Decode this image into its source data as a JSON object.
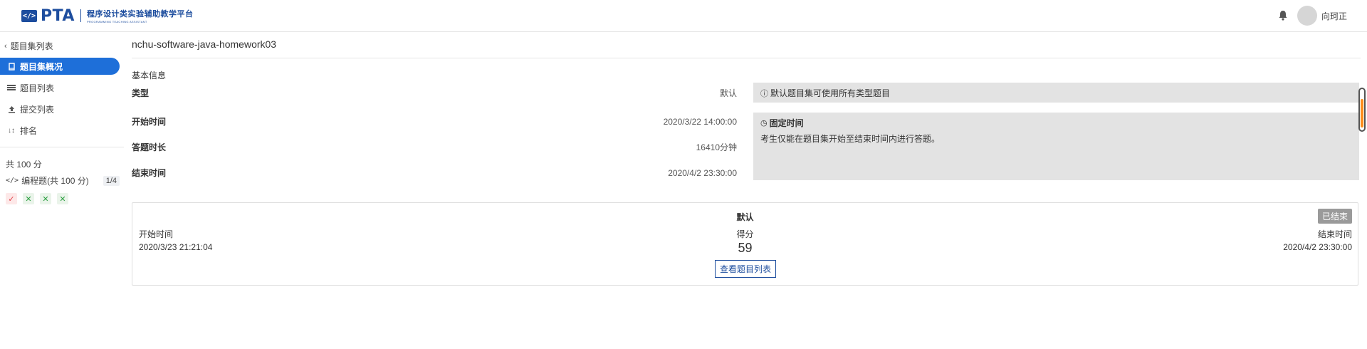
{
  "header": {
    "logo_text": "PTA",
    "logo_sub_cn": "程序设计类实验辅助教学平台",
    "logo_sub_en": "PROGRAMMING TEACHING ASSISTANT",
    "username": "向珂正"
  },
  "sidebar": {
    "back_label": "题目集列表",
    "items": [
      {
        "label": "题目集概况",
        "icon": "book-icon",
        "active": true
      },
      {
        "label": "题目列表",
        "icon": "list-icon",
        "active": false
      },
      {
        "label": "提交列表",
        "icon": "upload-icon",
        "active": false
      },
      {
        "label": "排名",
        "icon": "sort-icon",
        "active": false
      }
    ],
    "total_score": "共 100 分",
    "programming_label": "编程题(共 100 分)",
    "programming_count": "1/4",
    "marks": [
      "✓",
      "✕",
      "✕",
      "✕"
    ]
  },
  "main": {
    "title": "nchu-software-java-homework03",
    "section_label": "基本信息",
    "info": [
      {
        "key": "类型",
        "value": "默认"
      },
      {
        "key": "开始时间",
        "value": "2020/3/22 14:00:00"
      },
      {
        "key": "答题时长",
        "value": "16410分钟"
      },
      {
        "key": "结束时间",
        "value": "2020/4/2 23:30:00"
      }
    ],
    "note_type": "默认题目集可使用所有类型题目",
    "note_fixed_title": "固定时间",
    "note_fixed_desc": "考生仅能在题目集开始至结束时间内进行答题。"
  },
  "card": {
    "title": "默认",
    "badge": "已结束",
    "start_label": "开始时间",
    "start_value": "2020/3/23 21:21:04",
    "score_label": "得分",
    "score_value": "59",
    "end_label": "结束时间",
    "end_value": "2020/4/2 23:30:00",
    "button_label": "查看题目列表"
  },
  "colors": {
    "brand": "#1d4d9e",
    "active_nav": "#1e6fd9",
    "ok_mark": "#e0444b",
    "bad_mark": "#2ea043",
    "badge_bg": "#9a9a9a",
    "note_bg": "#e3e3e3"
  }
}
